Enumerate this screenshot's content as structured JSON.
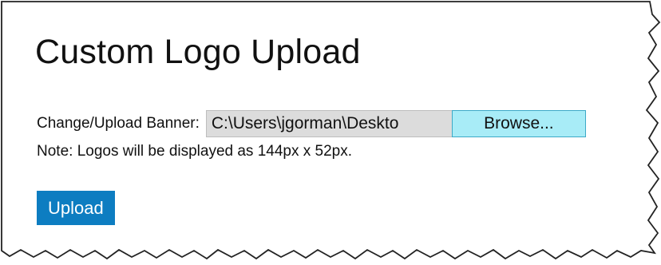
{
  "page": {
    "title": "Custom Logo Upload"
  },
  "upload": {
    "label": "Change/Upload Banner:",
    "file_path": "C:\\Users\\jgorman\\Deskto",
    "browse_label": "Browse...",
    "note": "Note: Logos will be displayed as 144px x 52px.",
    "upload_label": "Upload"
  },
  "colors": {
    "browse_button": "#a8ecf7",
    "upload_button": "#0d7dc1",
    "file_field": "#dcdcdc"
  }
}
